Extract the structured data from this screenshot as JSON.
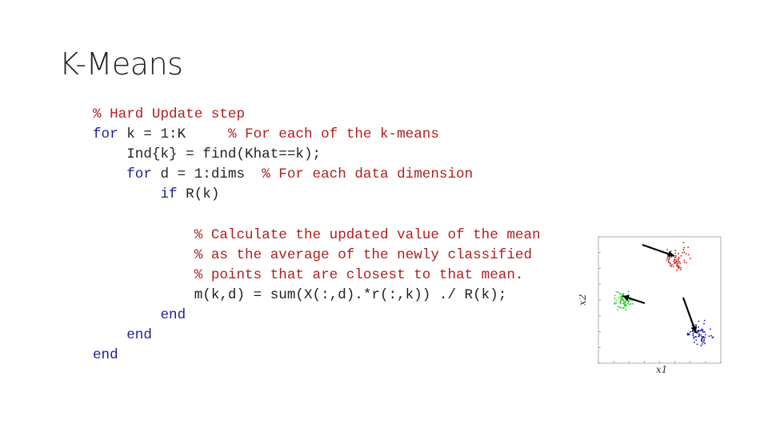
{
  "slide": {
    "title": "K-Means"
  },
  "code": {
    "lines": [
      {
        "indent": "",
        "kw": "",
        "text": "",
        "comment": "% Hard Update step"
      },
      {
        "indent": "",
        "kw": "for",
        "text": " k = 1:K     ",
        "comment": "% For each of the k-means"
      },
      {
        "indent": "    ",
        "kw": "",
        "text": "Ind{k} = find(Khat==k);",
        "comment": ""
      },
      {
        "indent": "    ",
        "kw": "for",
        "text": " d = 1:dims  ",
        "comment": "% For each data dimension"
      },
      {
        "indent": "        ",
        "kw": "if",
        "text": " R(k)",
        "comment": ""
      },
      {
        "indent": "",
        "kw": "",
        "text": "",
        "comment": ""
      },
      {
        "indent": "            ",
        "kw": "",
        "text": "",
        "comment": "% Calculate the updated value of the mean"
      },
      {
        "indent": "            ",
        "kw": "",
        "text": "",
        "comment": "% as the average of the newly classified"
      },
      {
        "indent": "            ",
        "kw": "",
        "text": "",
        "comment": "% points that are closest to that mean."
      },
      {
        "indent": "            ",
        "kw": "",
        "text": "m(k,d) = sum(X(:,d).*r(:,k)) ./ R(k);",
        "comment": ""
      },
      {
        "indent": "        ",
        "kw": "end",
        "text": "",
        "comment": ""
      },
      {
        "indent": "    ",
        "kw": "end",
        "text": "",
        "comment": ""
      },
      {
        "indent": "",
        "kw": "end",
        "text": "",
        "comment": ""
      }
    ]
  },
  "figure": {
    "xlabel": "x1",
    "ylabel": "x2",
    "clusters": [
      {
        "color": "#d42020"
      },
      {
        "color": "#22cc22"
      },
      {
        "color": "#1a1aa8"
      }
    ],
    "arrow_color": "#000000"
  }
}
